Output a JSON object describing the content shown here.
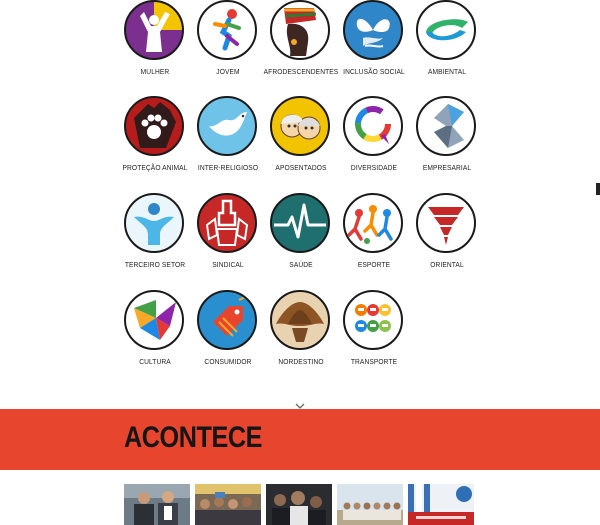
{
  "categories": [
    {
      "label": "MULHER",
      "icon": "woman-raising-arms-icon"
    },
    {
      "label": "JOVEM",
      "icon": "running-youth-icon"
    },
    {
      "label": "AFRODESCENDENTES",
      "icon": "african-woman-profile-icon"
    },
    {
      "label": "INCLUSÃO SOCIAL",
      "icon": "butterfly-ribbon-icon"
    },
    {
      "label": "AMBIENTAL",
      "icon": "green-loop-icon"
    },
    {
      "label": "PROTEÇÃO ANIMAL",
      "icon": "paw-print-hand-icon"
    },
    {
      "label": "INTER-RELIGIOSO",
      "icon": "dove-icon"
    },
    {
      "label": "APOSENTADOS",
      "icon": "elderly-couple-icon"
    },
    {
      "label": "DIVERSIDADE",
      "icon": "rainbow-speech-bubble-icon"
    },
    {
      "label": "EMPRESARIAL",
      "icon": "metal-ribbon-icon"
    },
    {
      "label": "TERCEIRO SETOR",
      "icon": "people-circle-icon"
    },
    {
      "label": "SINDICAL",
      "icon": "raised-fists-icon"
    },
    {
      "label": "SAÚDE",
      "icon": "heartbeat-line-icon"
    },
    {
      "label": "ESPORTE",
      "icon": "athletes-icon"
    },
    {
      "label": "ORIENTAL",
      "icon": "red-tornado-icon"
    },
    {
      "label": "CULTURA",
      "icon": "colorful-origami-icon"
    },
    {
      "label": "CONSUMIDOR",
      "icon": "price-tag-icon"
    },
    {
      "label": "NORDESTINO",
      "icon": "leather-hat-icon"
    },
    {
      "label": "TRANSPORTE",
      "icon": "transport-modes-icon"
    }
  ],
  "section": {
    "title": "ACONTECE",
    "accent_color": "#e8452f"
  },
  "thumbnails": [
    {
      "icon": "photo-two-men-icon"
    },
    {
      "icon": "photo-audience-icon"
    },
    {
      "icon": "photo-crowd-icon"
    },
    {
      "icon": "photo-group-outdoor-icon"
    },
    {
      "icon": "photo-conference-icon"
    }
  ]
}
